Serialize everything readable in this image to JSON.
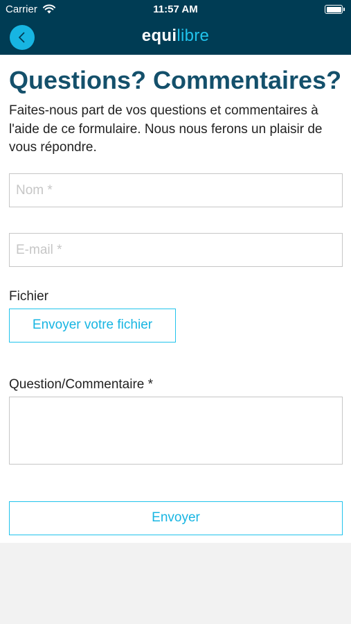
{
  "status_bar": {
    "carrier": "Carrier",
    "time": "11:57 AM"
  },
  "nav": {
    "logo_part1": "equi",
    "logo_part2": "libre",
    "back_icon": "chevron-left-icon",
    "accent": "#17b5e2",
    "bar_color": "#003c54"
  },
  "form": {
    "title": "Questions? Commentaires?",
    "intro": "Faites-nous part de vos questions et commentaires à l'aide de ce formulaire. Nous nous ferons un plaisir de vous répondre.",
    "name_placeholder": "Nom *",
    "email_placeholder": "E-mail *",
    "file_label": "Fichier",
    "file_button": "Envoyer votre fichier",
    "question_label": "Question/Commentaire *",
    "submit_button": "Envoyer"
  }
}
